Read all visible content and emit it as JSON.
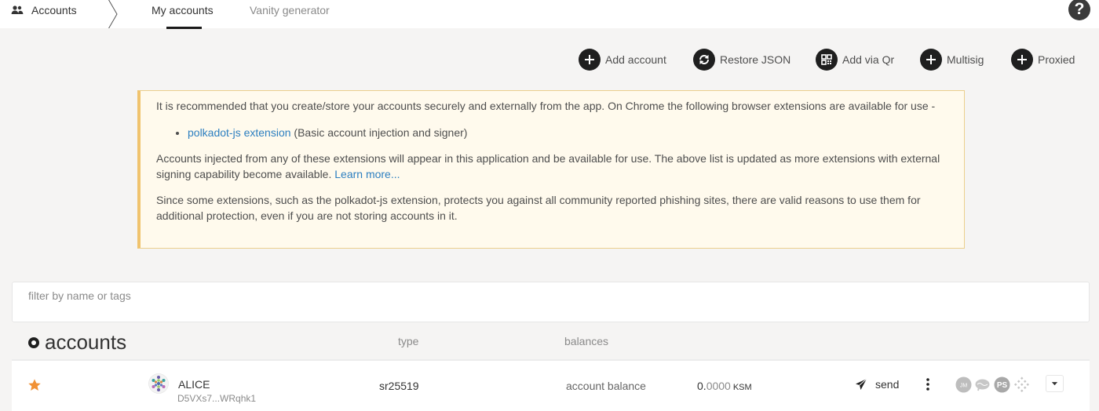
{
  "nav": {
    "app_label": "Accounts",
    "tabs": [
      {
        "label": "My accounts",
        "active": true
      },
      {
        "label": "Vanity generator",
        "active": false
      }
    ],
    "help_icon": "question-circle-icon"
  },
  "actions": [
    {
      "label": "Add account",
      "icon": "plus-icon"
    },
    {
      "label": "Restore JSON",
      "icon": "sync-icon"
    },
    {
      "label": "Add via Qr",
      "icon": "qrcode-icon"
    },
    {
      "label": "Multisig",
      "icon": "plus-icon"
    },
    {
      "label": "Proxied",
      "icon": "plus-icon"
    }
  ],
  "notice": {
    "intro": "It is recommended that you create/store your accounts securely and externally from the app. On Chrome the following browser extensions are available for use -",
    "extension_link": "polkadot-js extension",
    "extension_desc": "(Basic account injection and signer)",
    "para2": "Accounts injected from any of these extensions will appear in this application and be available for use. The above list is updated as more extensions with external signing capability become available.",
    "learn_more": "Learn more...",
    "para3": "Since some extensions, such as the polkadot-js extension, protects you against all community reported phishing sites, there are valid reasons to use them for additional protection, even if you are not storing accounts in it."
  },
  "filter": {
    "placeholder": "filter by name or tags",
    "value": ""
  },
  "table": {
    "title": "accounts",
    "col_type": "type",
    "col_balances": "balances"
  },
  "accounts": [
    {
      "name": "ALICE",
      "address": "D5VXs7...WRqhk1",
      "type": "sr25519",
      "balance_label": "account balance",
      "balance_int": "0.",
      "balance_frac": "0000",
      "balance_unit": "KSM",
      "send_label": "send",
      "favorite": true
    }
  ],
  "colors": {
    "accent_dark": "#1f1f1f",
    "notice_bg": "#fffaed",
    "notice_border": "#f0c36d",
    "link": "#2d7fc0",
    "star": "#f19135"
  }
}
